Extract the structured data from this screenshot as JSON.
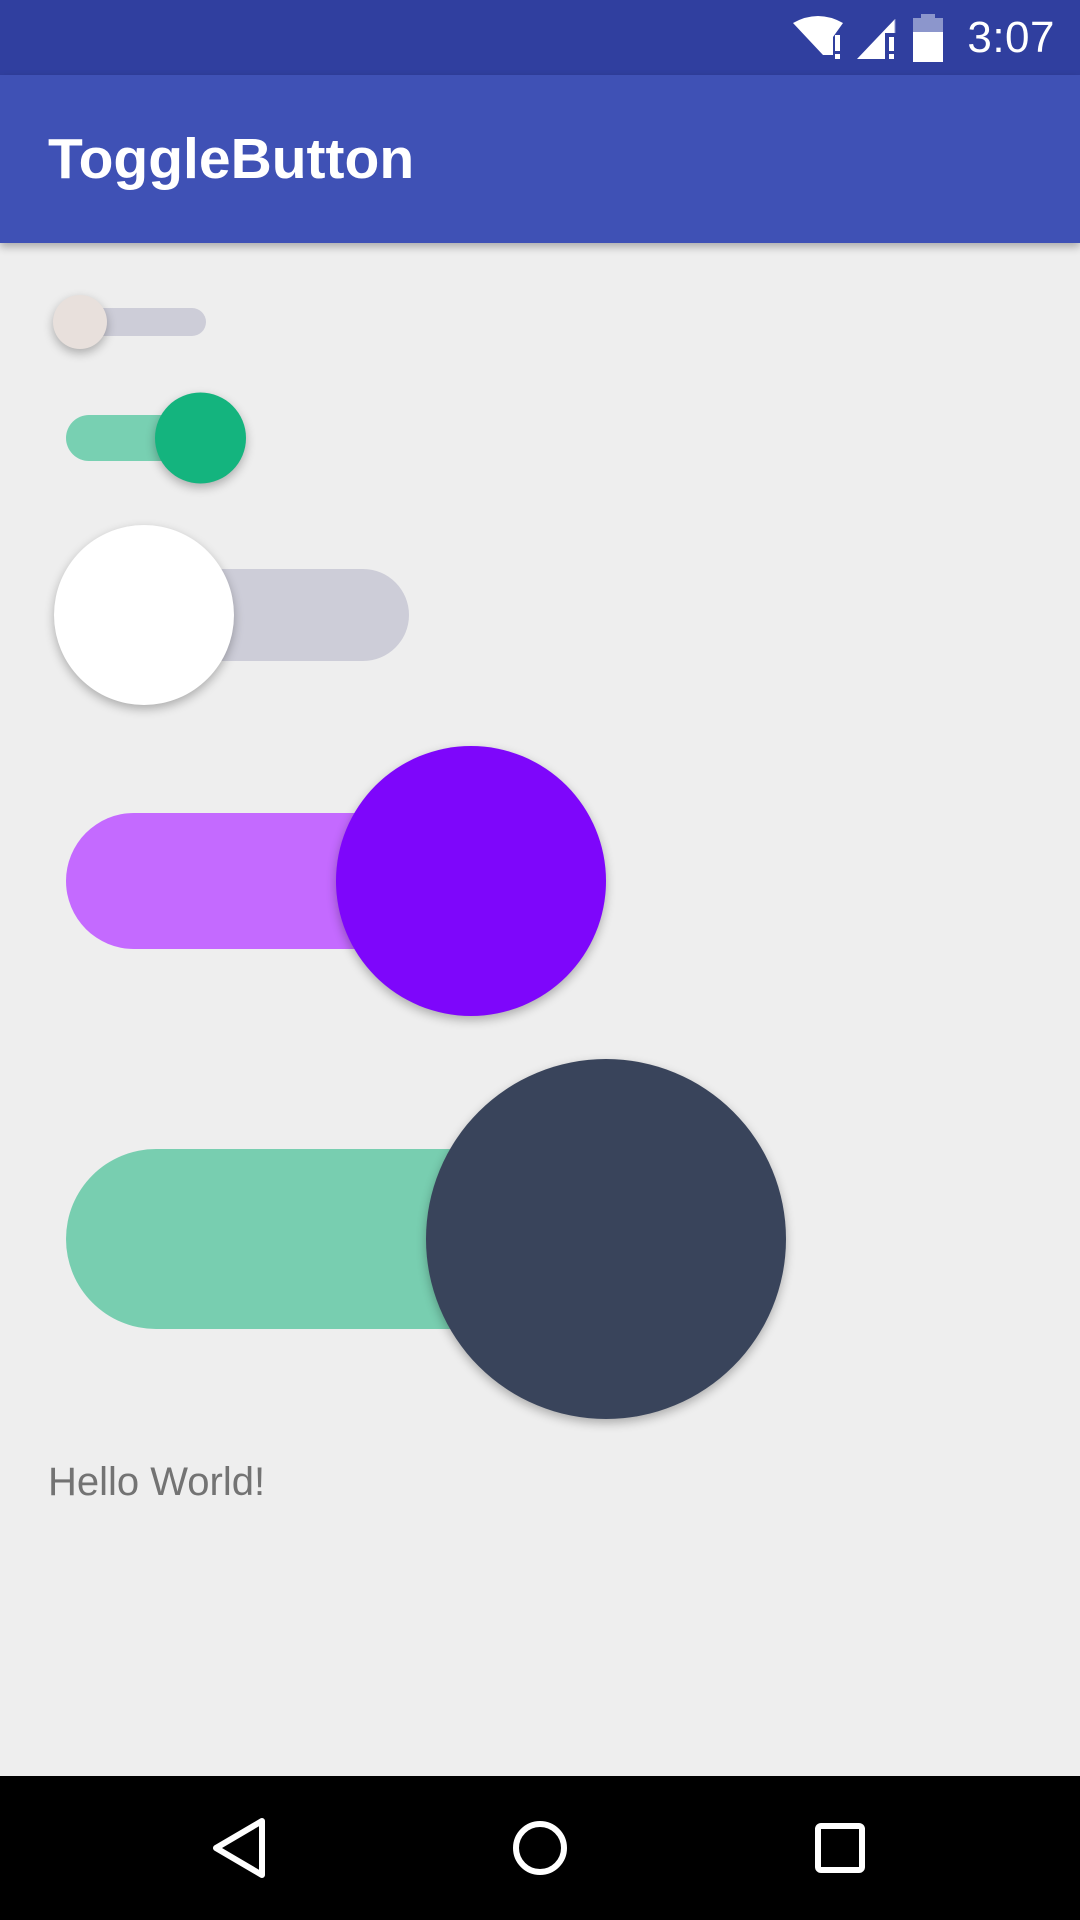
{
  "status_bar": {
    "time": "3:07",
    "icons": [
      "wifi-alert-icon",
      "signal-alert-icon",
      "battery-icon"
    ],
    "color": "#303f9f"
  },
  "app_bar": {
    "title": "ToggleButton",
    "color": "#3f51b5"
  },
  "toggles": [
    {
      "name": "toggle-1",
      "checked": false,
      "track_color": "#cdcdd8",
      "thumb_color": "#e8e0dc"
    },
    {
      "name": "toggle-2",
      "checked": true,
      "track_color": "#78d0b2",
      "thumb_color": "#14b47e"
    },
    {
      "name": "toggle-3",
      "checked": false,
      "track_color": "#cdcdd8",
      "thumb_color": "#ffffff"
    },
    {
      "name": "toggle-4",
      "checked": true,
      "track_color": "#c46aff",
      "thumb_color": "#7e06fb"
    },
    {
      "name": "toggle-5",
      "checked": true,
      "track_color": "#78ceb0",
      "thumb_color": "#39445b"
    }
  ],
  "content": {
    "hello_text": "Hello World!"
  },
  "nav_bar": {
    "buttons": [
      "back-icon",
      "home-icon",
      "recents-icon"
    ]
  }
}
